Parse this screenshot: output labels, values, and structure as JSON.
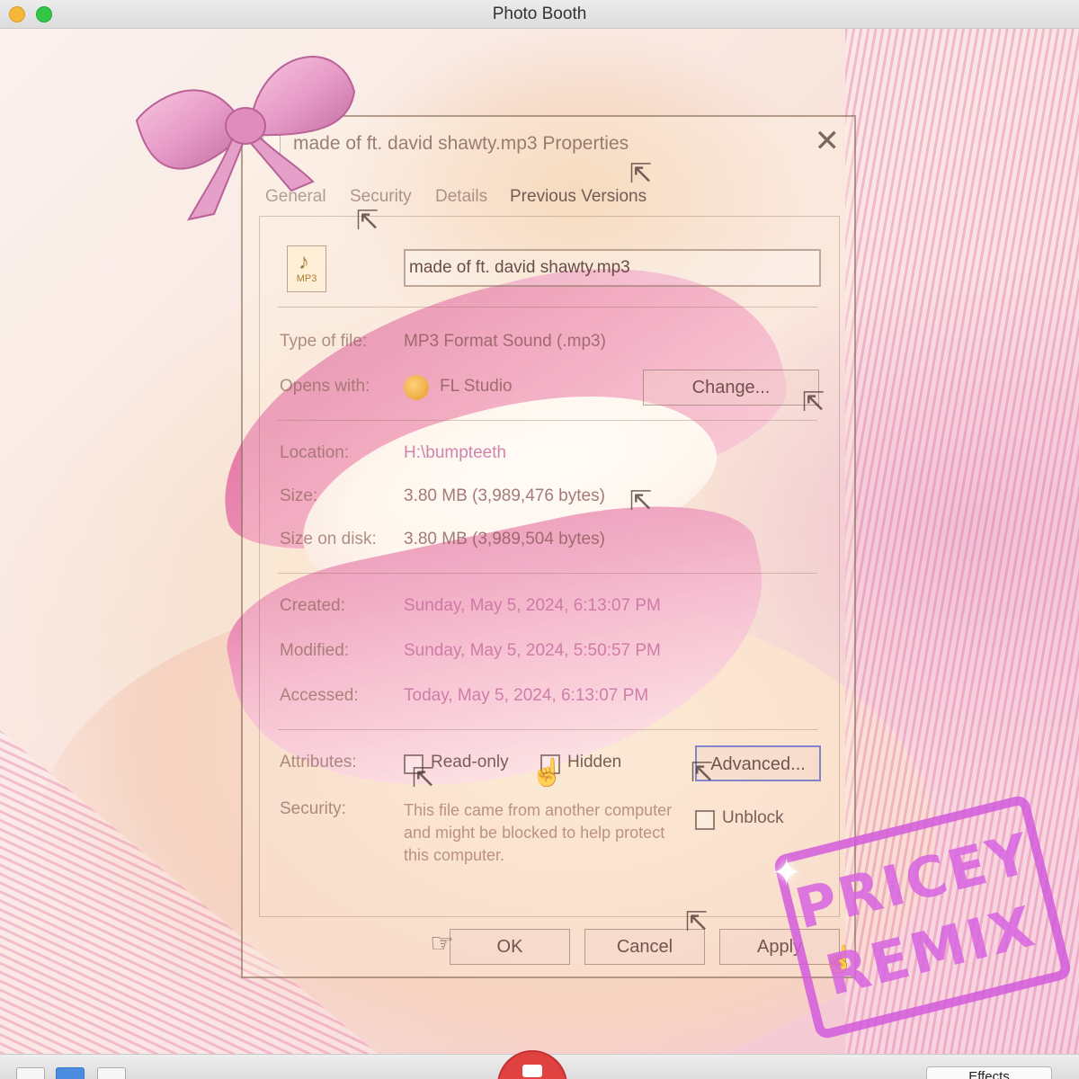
{
  "window": {
    "title": "Photo Booth"
  },
  "dialog": {
    "title": "made of ft. david shawty.mp3 Properties",
    "close_glyph": "✕",
    "tabs": [
      "General",
      "Security",
      "Details",
      "Previous Versions"
    ],
    "file_name": "made of ft. david shawty.mp3",
    "file_icon_label": "MP3",
    "type_label": "Type of file:",
    "type_value": "MP3 Format Sound (.mp3)",
    "opens_label": "Opens with:",
    "opens_value": "FL Studio",
    "change_label": "Change...",
    "location_label": "Location:",
    "location_value": "H:\\bumpteeth",
    "size_label": "Size:",
    "size_value": "3.80 MB (3,989,476 bytes)",
    "size_disk_label": "Size on disk:",
    "size_disk_value": "3.80 MB (3,989,504 bytes)",
    "created_label": "Created:",
    "created_value": "Sunday, May 5, 2024, 6:13:07 PM",
    "modified_label": "Modified:",
    "modified_value": "Sunday, May 5, 2024, 5:50:57 PM",
    "accessed_label": "Accessed:",
    "accessed_value": "Today, May 5, 2024, 6:13:07 PM",
    "attributes_label": "Attributes:",
    "readonly_label": "Read-only",
    "hidden_label": "Hidden",
    "advanced_label": "Advanced...",
    "security_label": "Security:",
    "security_text": "This file came from another computer and might be blocked to help protect this computer.",
    "unblock_label": "Unblock",
    "ok_label": "OK",
    "cancel_label": "Cancel",
    "apply_label": "Apply"
  },
  "stamp": {
    "line1": "PRICEY",
    "line2": "REMIX",
    "color": "#d764e1"
  },
  "toolbar": {
    "effects_label": "Effects"
  },
  "icons": {
    "bow": "pink-bow-icon",
    "cursor": "mouse-pointer-icon",
    "hand": "pointing-hand-icon",
    "camera": "camera-icon"
  }
}
